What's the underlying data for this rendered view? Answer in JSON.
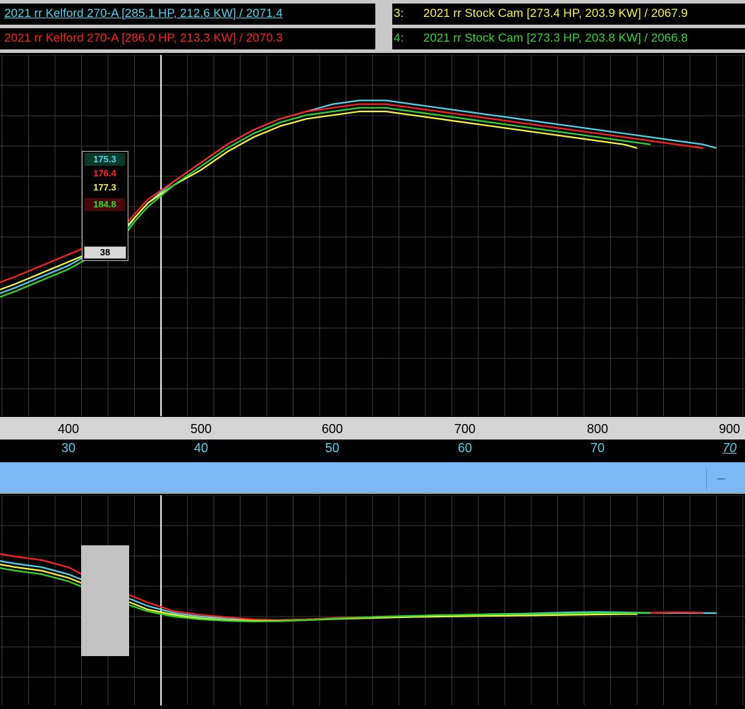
{
  "legend": [
    {
      "index": "",
      "label": "2021 rr Kelford 270-A [285.1 HP, 212.6 KW] / 2071.4",
      "color": "#4fd4ea",
      "underline": true
    },
    {
      "index": "",
      "label": "2021 rr Kelford 270-A [286.0 HP, 213.3 KW] / 2070.3",
      "color": "#ff2020",
      "underline": false
    },
    {
      "index": "3:",
      "label": "2021 rr Stock Cam [273.4 HP, 203.9 KW] / 2067.9",
      "color": "#f5f53a",
      "underline": false
    },
    {
      "index": "4:",
      "label": "2021 rr Stock Cam [273.3 HP, 203.8 KW] / 2066.8",
      "color": "#2ed82e",
      "underline": false
    }
  ],
  "x_axis": {
    "primary_ticks": [
      "400",
      "500",
      "600",
      "700",
      "800",
      "900"
    ],
    "secondary_ticks": [
      "30",
      "40",
      "50",
      "60",
      "70",
      "70"
    ]
  },
  "cursor_readout": {
    "values": [
      {
        "text": "175.3",
        "color": "#4fd4ea",
        "bg": "#0a3a2a"
      },
      {
        "text": "176.4",
        "color": "#ff2020",
        "bg": "#000000"
      },
      {
        "text": "177.3",
        "color": "#f5f53a",
        "bg": "#000000"
      },
      {
        "text": "184.8",
        "color": "#2ed82e",
        "bg": "#4a0808"
      }
    ],
    "index": "38"
  },
  "colors": {
    "cyan": "#4fd4ea",
    "red": "#ff2020",
    "yellow": "#f5f53a",
    "green": "#2ed82e"
  },
  "chart_data": [
    {
      "type": "line",
      "grid": true,
      "xlim": [
        345,
        900
      ],
      "cursor_x": 470,
      "series": [
        {
          "color": "#4fd4ea",
          "x": [
            345,
            360,
            380,
            400,
            420,
            440,
            450,
            460,
            480,
            500,
            520,
            540,
            560,
            580,
            600,
            620,
            640,
            660,
            680,
            700,
            720,
            740,
            760,
            780,
            800,
            820,
            840,
            860,
            880,
            890
          ],
          "y": [
            0.25,
            0.23,
            0.2,
            0.17,
            0.13,
            0.09,
            0.04,
            0.0,
            -0.06,
            -0.11,
            -0.16,
            -0.2,
            -0.23,
            -0.25,
            -0.27,
            -0.28,
            -0.28,
            -0.27,
            -0.26,
            -0.25,
            -0.24,
            -0.23,
            -0.22,
            -0.21,
            -0.2,
            -0.19,
            -0.18,
            -0.17,
            -0.16,
            -0.15
          ]
        },
        {
          "color": "#ff2020",
          "x": [
            345,
            360,
            380,
            400,
            420,
            440,
            450,
            460,
            480,
            500,
            520,
            540,
            560,
            580,
            600,
            620,
            640,
            660,
            680,
            700,
            720,
            740,
            760,
            780,
            800,
            820,
            840,
            860,
            880
          ],
          "y": [
            0.22,
            0.2,
            0.17,
            0.14,
            0.11,
            0.07,
            0.03,
            -0.01,
            -0.06,
            -0.11,
            -0.16,
            -0.2,
            -0.23,
            -0.25,
            -0.26,
            -0.27,
            -0.27,
            -0.26,
            -0.25,
            -0.24,
            -0.23,
            -0.22,
            -0.21,
            -0.2,
            -0.19,
            -0.18,
            -0.17,
            -0.16,
            -0.15
          ]
        },
        {
          "color": "#f5f53a",
          "x": [
            345,
            360,
            380,
            400,
            420,
            440,
            450,
            460,
            480,
            500,
            520,
            540,
            560,
            580,
            600,
            620,
            640,
            660,
            680,
            700,
            720,
            740,
            760,
            780,
            800,
            820,
            830
          ],
          "y": [
            0.24,
            0.22,
            0.19,
            0.16,
            0.13,
            0.08,
            0.04,
            0.0,
            -0.05,
            -0.09,
            -0.14,
            -0.18,
            -0.21,
            -0.23,
            -0.24,
            -0.25,
            -0.25,
            -0.24,
            -0.23,
            -0.22,
            -0.21,
            -0.2,
            -0.19,
            -0.18,
            -0.17,
            -0.16,
            -0.15
          ]
        },
        {
          "color": "#2ed82e",
          "x": [
            345,
            360,
            380,
            400,
            420,
            440,
            450,
            460,
            480,
            500,
            520,
            540,
            560,
            580,
            600,
            620,
            640,
            660,
            680,
            700,
            720,
            740,
            760,
            780,
            800,
            820,
            840
          ],
          "y": [
            0.26,
            0.24,
            0.21,
            0.18,
            0.14,
            0.1,
            0.05,
            0.01,
            -0.05,
            -0.1,
            -0.15,
            -0.19,
            -0.22,
            -0.24,
            -0.25,
            -0.26,
            -0.26,
            -0.25,
            -0.24,
            -0.23,
            -0.22,
            -0.21,
            -0.2,
            -0.19,
            -0.18,
            -0.17,
            -0.16
          ]
        }
      ]
    },
    {
      "type": "line",
      "grid": true,
      "xlim": [
        345,
        900
      ],
      "cursor_x": 470,
      "series": [
        {
          "color": "#4fd4ea",
          "x": [
            345,
            360,
            380,
            400,
            420,
            440,
            460,
            480,
            500,
            520,
            540,
            560,
            580,
            600,
            620,
            640,
            660,
            680,
            700,
            720,
            740,
            760,
            780,
            800,
            820,
            840,
            860,
            880,
            890
          ],
          "y": [
            0.18,
            0.17,
            0.16,
            0.14,
            0.11,
            0.08,
            0.05,
            0.03,
            0.02,
            0.015,
            0.01,
            0.01,
            0.012,
            0.015,
            0.018,
            0.02,
            0.022,
            0.024,
            0.025,
            0.027,
            0.028,
            0.03,
            0.032,
            0.033,
            0.032,
            0.031,
            0.03,
            0.03,
            0.03
          ]
        },
        {
          "color": "#ff2020",
          "x": [
            345,
            360,
            380,
            400,
            420,
            440,
            460,
            480,
            500,
            520,
            540,
            560,
            580,
            600,
            620,
            640,
            660,
            680,
            700,
            720,
            740,
            760,
            780,
            800,
            820,
            840,
            860,
            880
          ],
          "y": [
            0.2,
            0.19,
            0.18,
            0.16,
            0.12,
            0.09,
            0.06,
            0.035,
            0.025,
            0.018,
            0.012,
            0.01,
            0.012,
            0.016,
            0.018,
            0.02,
            0.021,
            0.022,
            0.024,
            0.025,
            0.026,
            0.027,
            0.028,
            0.029,
            0.03,
            0.031,
            0.032,
            0.031
          ]
        },
        {
          "color": "#f5f53a",
          "x": [
            345,
            360,
            380,
            400,
            420,
            440,
            460,
            480,
            500,
            520,
            540,
            560,
            580,
            600,
            620,
            640,
            660,
            680,
            700,
            720,
            740,
            760,
            780,
            800,
            820,
            830
          ],
          "y": [
            0.17,
            0.16,
            0.15,
            0.13,
            0.1,
            0.07,
            0.04,
            0.025,
            0.015,
            0.01,
            0.008,
            0.008,
            0.01,
            0.013,
            0.015,
            0.017,
            0.019,
            0.02,
            0.021,
            0.022,
            0.023,
            0.024,
            0.025,
            0.026,
            0.027,
            0.027
          ]
        },
        {
          "color": "#2ed82e",
          "x": [
            345,
            360,
            380,
            400,
            420,
            440,
            460,
            480,
            500,
            520,
            540,
            560,
            580,
            600,
            620,
            640,
            660,
            680,
            700,
            720,
            740,
            760,
            780,
            800,
            820,
            840
          ],
          "y": [
            0.16,
            0.15,
            0.14,
            0.12,
            0.09,
            0.06,
            0.035,
            0.02,
            0.012,
            0.008,
            0.006,
            0.007,
            0.01,
            0.014,
            0.017,
            0.02,
            0.022,
            0.024,
            0.025,
            0.026,
            0.027,
            0.028,
            0.029,
            0.03,
            0.03,
            0.03
          ]
        }
      ]
    }
  ]
}
